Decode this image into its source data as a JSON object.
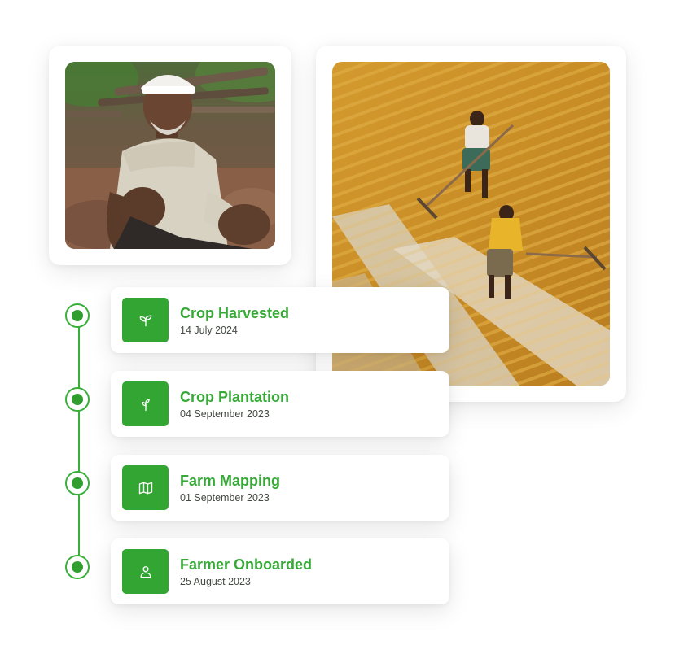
{
  "timeline": {
    "accent_color": "#36a936",
    "events": [
      {
        "title": "Crop Harvested",
        "date": "14 July 2024",
        "icon": "sprout-icon"
      },
      {
        "title": "Crop Plantation",
        "date": "04 September 2023",
        "icon": "seedling-icon"
      },
      {
        "title": "Farm Mapping",
        "date": "01 September 2023",
        "icon": "map-icon"
      },
      {
        "title": "Farmer Onboarded",
        "date": "25 August 2023",
        "icon": "user-icon"
      }
    ]
  }
}
